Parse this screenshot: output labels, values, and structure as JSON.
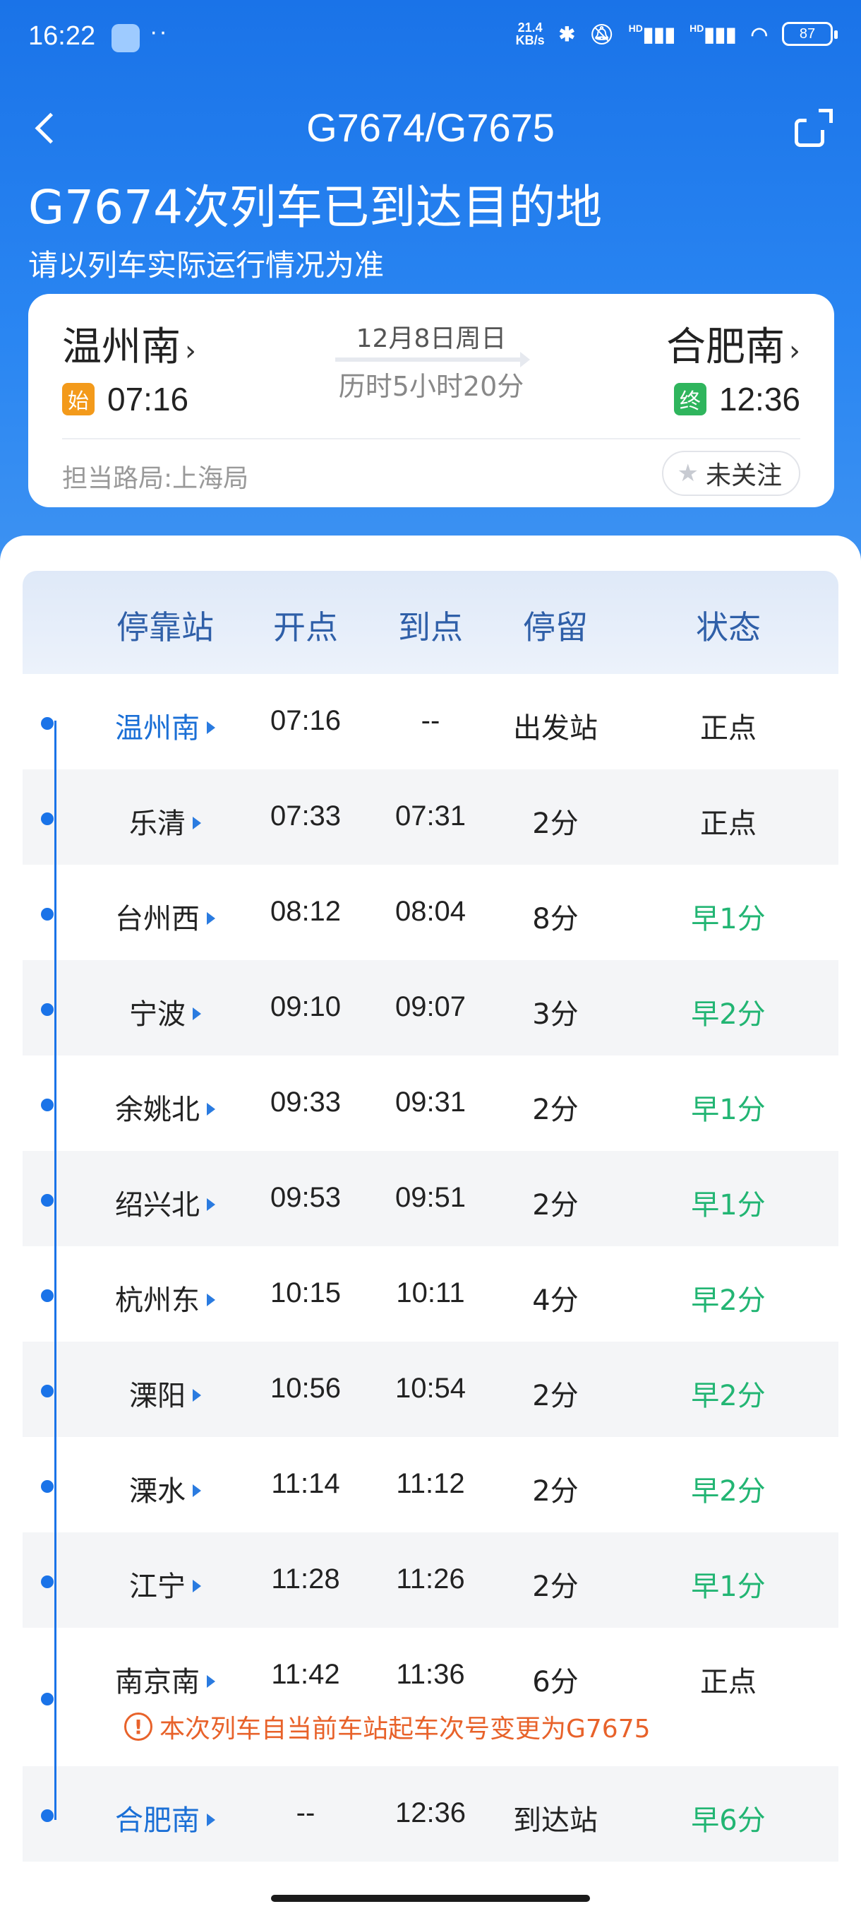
{
  "status_bar": {
    "time": "16:22",
    "speed_value": "21.4",
    "speed_unit": "KB/s",
    "dots": "··",
    "signal1": "HD",
    "signal2": "HD",
    "battery": "87"
  },
  "nav": {
    "title": "G7674/G7675"
  },
  "headline": "G7674次列车已到达目的地",
  "subline": "请以列车实际运行情况为准",
  "card": {
    "from_station": "温州南",
    "to_station": "合肥南",
    "date": "12月8日周日",
    "duration": "历时5小时20分",
    "start_tag": "始",
    "end_tag": "终",
    "depart_time": "07:16",
    "arrive_time": "12:36",
    "bureau": "担当路局:上海局",
    "follow_label": "未关注"
  },
  "table": {
    "headers": [
      "停靠站",
      "开点",
      "到点",
      "停留",
      "状态"
    ],
    "rows": [
      {
        "station": "温州南",
        "depart": "07:16",
        "arrive": "--",
        "stay": "出发站",
        "status": "正点",
        "status_type": "normal",
        "highlight": true
      },
      {
        "station": "乐清",
        "depart": "07:33",
        "arrive": "07:31",
        "stay": "2分",
        "status": "正点",
        "status_type": "normal",
        "highlight": false
      },
      {
        "station": "台州西",
        "depart": "08:12",
        "arrive": "08:04",
        "stay": "8分",
        "status": "早1分",
        "status_type": "early",
        "highlight": false
      },
      {
        "station": "宁波",
        "depart": "09:10",
        "arrive": "09:07",
        "stay": "3分",
        "status": "早2分",
        "status_type": "early",
        "highlight": false
      },
      {
        "station": "余姚北",
        "depart": "09:33",
        "arrive": "09:31",
        "stay": "2分",
        "status": "早1分",
        "status_type": "early",
        "highlight": false
      },
      {
        "station": "绍兴北",
        "depart": "09:53",
        "arrive": "09:51",
        "stay": "2分",
        "status": "早1分",
        "status_type": "early",
        "highlight": false
      },
      {
        "station": "杭州东",
        "depart": "10:15",
        "arrive": "10:11",
        "stay": "4分",
        "status": "早2分",
        "status_type": "early",
        "highlight": false
      },
      {
        "station": "溧阳",
        "depart": "10:56",
        "arrive": "10:54",
        "stay": "2分",
        "status": "早2分",
        "status_type": "early",
        "highlight": false
      },
      {
        "station": "溧水",
        "depart": "11:14",
        "arrive": "11:12",
        "stay": "2分",
        "status": "早2分",
        "status_type": "early",
        "highlight": false
      },
      {
        "station": "江宁",
        "depart": "11:28",
        "arrive": "11:26",
        "stay": "2分",
        "status": "早1分",
        "status_type": "early",
        "highlight": false
      },
      {
        "station": "南京南",
        "depart": "11:42",
        "arrive": "11:36",
        "stay": "6分",
        "status": "正点",
        "status_type": "normal",
        "highlight": false,
        "notice": "本次列车自当前车站起车次号变更为G7675"
      },
      {
        "station": "合肥南",
        "depart": "--",
        "arrive": "12:36",
        "stay": "到达站",
        "status": "早6分",
        "status_type": "early",
        "highlight": true
      }
    ]
  },
  "colors": {
    "header_blue": "#1a73e8",
    "early_green": "#22b573",
    "highlight_blue": "#1a6fd6",
    "notice_orange": "#e8622a"
  }
}
